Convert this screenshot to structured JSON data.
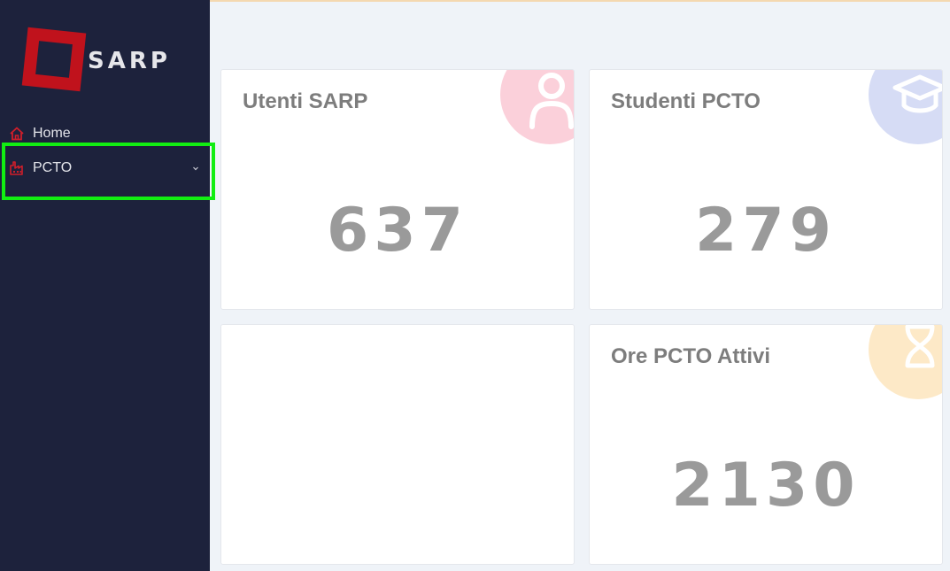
{
  "brand": {
    "name": "SARP",
    "accent": "#c0121c"
  },
  "sidebar": {
    "items": [
      {
        "label": "Home",
        "icon": "home-icon"
      },
      {
        "label": "PCTO",
        "icon": "factory-icon",
        "expandable": true
      }
    ]
  },
  "cards": [
    {
      "title": "Utenti SARP",
      "value": "637",
      "icon": "user-icon",
      "badge_color": "#fbd0da"
    },
    {
      "title": "Studenti PCTO",
      "value": "279",
      "icon": "graduation-cap-icon",
      "badge_color": "#d6dcf5"
    },
    {
      "title": "",
      "value": ""
    },
    {
      "title": "Ore PCTO Attivi",
      "value": "2130",
      "icon": "hourglass-icon",
      "badge_color": "#fde9c7"
    }
  ]
}
